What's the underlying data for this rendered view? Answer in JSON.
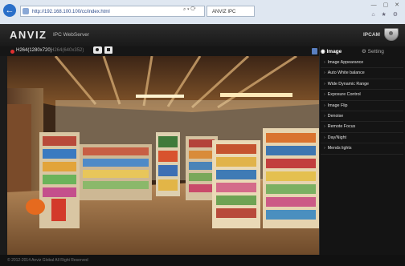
{
  "browser": {
    "url": "http://192.168.100.100/cc/index.html",
    "address_tools": "⌕ ▾ ⟳",
    "tab_title": "ANVIZ IPC",
    "window_controls": "— ▢ ✕",
    "toolbar_icons": "⌂ ★ ⚙"
  },
  "app": {
    "logo": "ANVIZ",
    "product_name": "IPC WebServer",
    "camera_name": "IPCAM"
  },
  "stream": {
    "main": "H264(1280x720)",
    "sub": "H264(640x352)"
  },
  "panel": {
    "tab_image": "Image",
    "tab_setting": "Setting",
    "items": [
      "Image Appearance",
      "Auto White balance",
      "Wide Dynamic Range",
      "Exposure Control",
      "Image Flip",
      "Denoise",
      "Remote Focus",
      "Day/Night",
      "Mends lights"
    ]
  },
  "footer": {
    "copyright": "© 2012-2014 Anviz Global All Right Reserved"
  }
}
